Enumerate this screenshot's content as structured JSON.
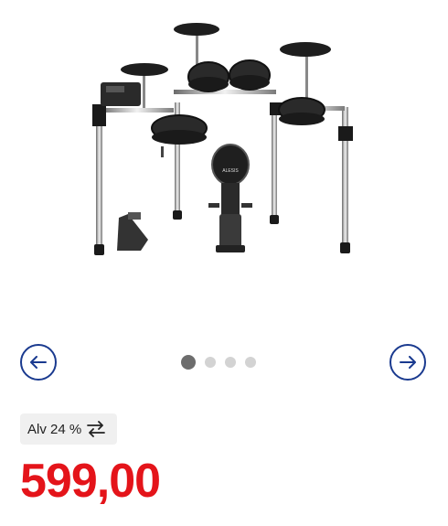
{
  "gallery": {
    "image_alt": "Electronic drum kit",
    "image_brand_text": "ALESIS",
    "total_images": 4,
    "active_index": 1,
    "prev_icon": "arrow-left-icon",
    "next_icon": "arrow-right-icon"
  },
  "vat": {
    "label": "Alv 24 %",
    "icon": "swap-arrows-icon"
  },
  "price": {
    "value": "599,00",
    "color": "#e4141a"
  },
  "accent_color": "#1a3a8f"
}
